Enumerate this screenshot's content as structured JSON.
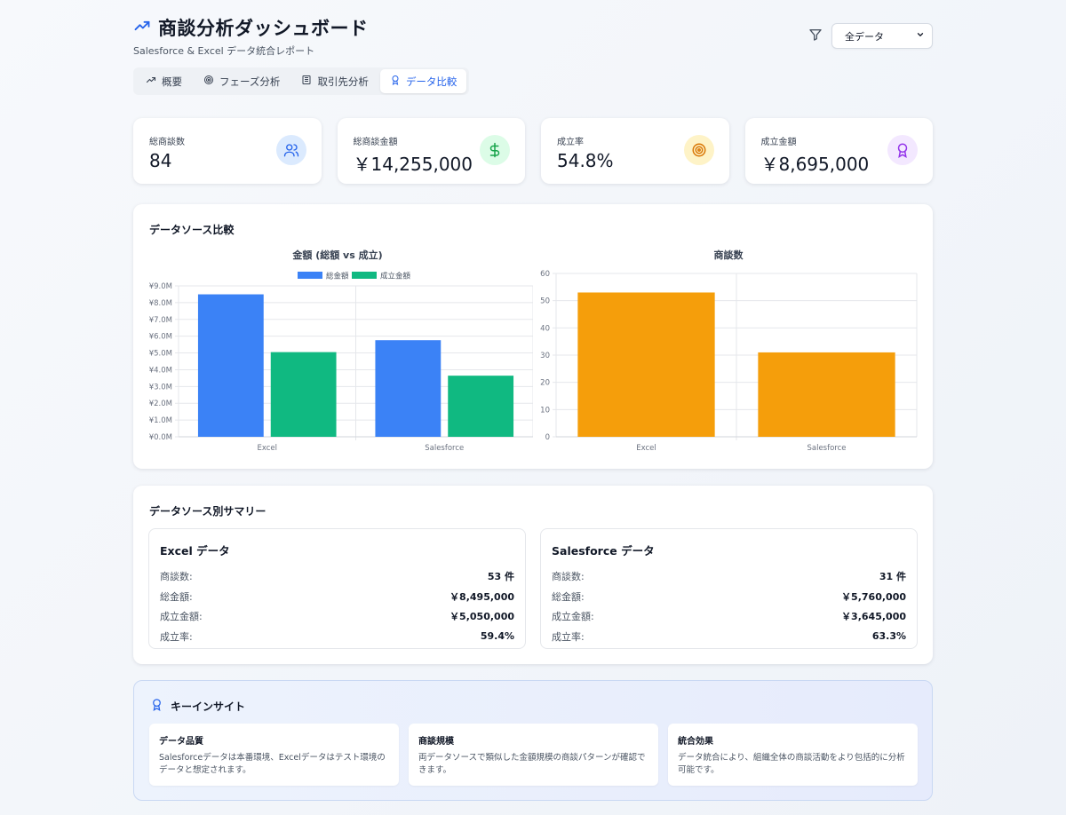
{
  "header": {
    "title": "商談分析ダッシュボード",
    "subtitle": "Salesforce & Excel データ統合レポート",
    "filter_value": "全データ"
  },
  "tabs": [
    {
      "label": "概要",
      "icon": "trending-up-icon"
    },
    {
      "label": "フェーズ分析",
      "icon": "target-icon"
    },
    {
      "label": "取引先分析",
      "icon": "building-icon"
    },
    {
      "label": "データ比較",
      "icon": "award-icon",
      "active": true
    }
  ],
  "kpis": [
    {
      "label": "総商談数",
      "value": "84",
      "icon": "users-icon",
      "bg": "#dbeafe",
      "fg": "#2563eb"
    },
    {
      "label": "総商談金額",
      "value": "￥14,255,000",
      "icon": "dollar-icon",
      "bg": "#dcfce7",
      "fg": "#16a34a"
    },
    {
      "label": "成立率",
      "value": "54.8%",
      "icon": "target-icon",
      "bg": "#fef3c7",
      "fg": "#d97706"
    },
    {
      "label": "成立金額",
      "value": "￥8,695,000",
      "icon": "award-icon",
      "bg": "#f3e8ff",
      "fg": "#9333ea"
    }
  ],
  "comparison": {
    "title": "データソース比較"
  },
  "chart_data": [
    {
      "type": "bar",
      "title": "金額 (総額 vs 成立)",
      "categories": [
        "Excel",
        "Salesforce"
      ],
      "series": [
        {
          "name": "総金額",
          "values": [
            8495000,
            5760000
          ],
          "color": "#3b82f6"
        },
        {
          "name": "成立金額",
          "values": [
            5050000,
            3645000
          ],
          "color": "#10b981"
        }
      ],
      "ylim": [
        0,
        9000000
      ],
      "yticks": [
        "¥0.0M",
        "¥1.0M",
        "¥2.0M",
        "¥3.0M",
        "¥4.0M",
        "¥5.0M",
        "¥6.0M",
        "¥7.0M",
        "¥8.0M",
        "¥9.0M"
      ],
      "legend": "top",
      "grid": true
    },
    {
      "type": "bar",
      "title": "商談数",
      "categories": [
        "Excel",
        "Salesforce"
      ],
      "series": [
        {
          "values": [
            53,
            31
          ],
          "color": "#f59e0b"
        }
      ],
      "ylim": [
        0,
        60
      ],
      "yticks": [
        "0",
        "10",
        "20",
        "30",
        "40",
        "50",
        "60"
      ],
      "grid": true
    }
  ],
  "summary": {
    "title": "データソース別サマリー",
    "sources": [
      {
        "name": "Excel データ",
        "rows": [
          {
            "k": "商談数:",
            "v": "53 件"
          },
          {
            "k": "総金額:",
            "v": "￥8,495,000"
          },
          {
            "k": "成立金額:",
            "v": "￥5,050,000"
          },
          {
            "k": "成立率:",
            "v": "59.4%"
          }
        ]
      },
      {
        "name": "Salesforce データ",
        "rows": [
          {
            "k": "商談数:",
            "v": "31 件"
          },
          {
            "k": "総金額:",
            "v": "￥5,760,000"
          },
          {
            "k": "成立金額:",
            "v": "￥3,645,000"
          },
          {
            "k": "成立率:",
            "v": "63.3%"
          }
        ]
      }
    ]
  },
  "insights": {
    "title": "キーインサイト",
    "items": [
      {
        "head": "データ品質",
        "text": "Salesforceデータは本番環境、Excelデータはテスト環境のデータと想定されます。"
      },
      {
        "head": "商談規模",
        "text": "両データソースで類似した金額規模の商談パターンが確認できます。"
      },
      {
        "head": "統合効果",
        "text": "データ統合により、組織全体の商談活動をより包括的に分析可能です。"
      }
    ]
  }
}
